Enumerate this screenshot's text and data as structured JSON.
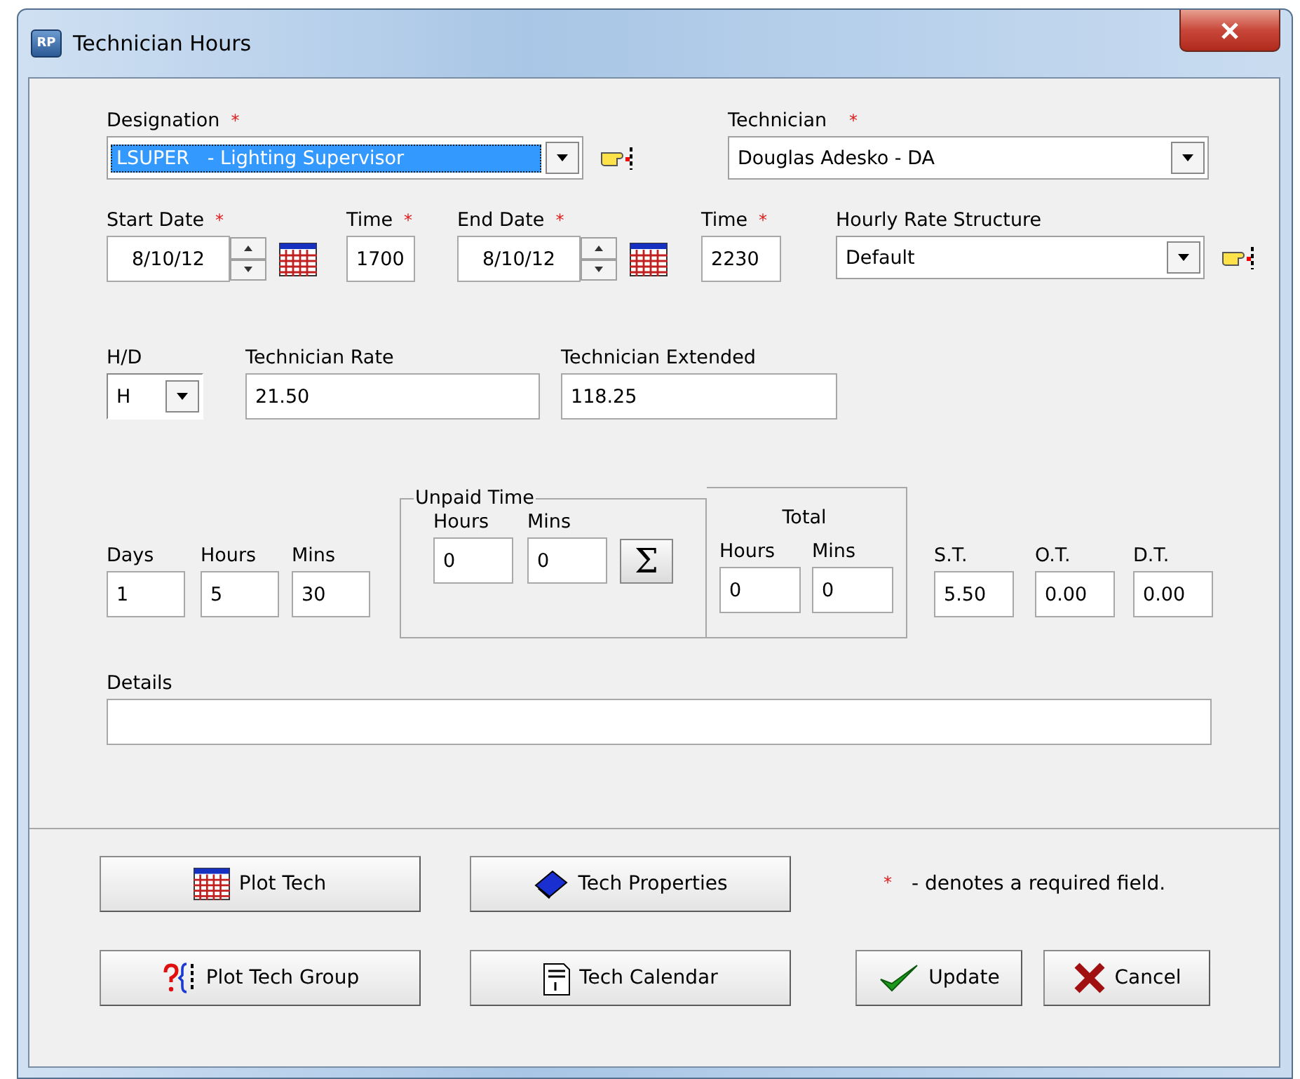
{
  "window": {
    "app_icon": "RP",
    "title": "Technician Hours"
  },
  "required_mark": "*",
  "designation": {
    "label": "Designation",
    "required": true,
    "value": "LSUPER   - Lighting Supervisor",
    "selected": true
  },
  "technician": {
    "label": "Technician",
    "required": true,
    "value": "Douglas Adesko - DA"
  },
  "start_date": {
    "label": "Start Date",
    "required": true,
    "value": "8/10/12"
  },
  "start_time": {
    "label": "Time",
    "required": true,
    "value": "1700"
  },
  "end_date": {
    "label": "End Date",
    "required": true,
    "value": "8/10/12"
  },
  "end_time": {
    "label": "Time",
    "required": true,
    "value": "2230"
  },
  "hourly_rate_structure": {
    "label": "Hourly Rate Structure",
    "required": false,
    "value": "Default"
  },
  "hd": {
    "label": "H/D",
    "value": "H"
  },
  "technician_rate": {
    "label": "Technician Rate",
    "value": "21.50"
  },
  "technician_extended": {
    "label": "Technician Extended",
    "value": "118.25"
  },
  "duration": [
    {
      "label": "Days",
      "value": "1"
    },
    {
      "label": "Hours",
      "value": "5"
    },
    {
      "label": "Mins",
      "value": "30"
    }
  ],
  "unpaid_time": {
    "title": "Unpaid Time",
    "fields": [
      {
        "label": "Hours",
        "value": "0"
      },
      {
        "label": "Mins",
        "value": "0"
      }
    ],
    "sum_button": "Σ"
  },
  "total": {
    "title": "Total",
    "fields": [
      {
        "label": "Hours",
        "value": "0"
      },
      {
        "label": "Mins",
        "value": "0"
      }
    ]
  },
  "rates": [
    {
      "label": "S.T.",
      "value": "5.50"
    },
    {
      "label": "O.T.",
      "value": "0.00"
    },
    {
      "label": "D.T.",
      "value": "0.00"
    }
  ],
  "details": {
    "label": "Details"
  },
  "buttons": [
    {
      "label": "Plot Tech",
      "kind": "calendar"
    },
    {
      "label": "Tech Properties",
      "kind": "book"
    },
    {
      "label": "Plot Tech Group",
      "kind": "group"
    },
    {
      "label": "Tech Calendar",
      "kind": "date"
    },
    {
      "label": "Update",
      "kind": "check"
    },
    {
      "label": "Cancel",
      "kind": "cross"
    }
  ],
  "note": {
    "mark": "*",
    "text": "- denotes a required field."
  }
}
